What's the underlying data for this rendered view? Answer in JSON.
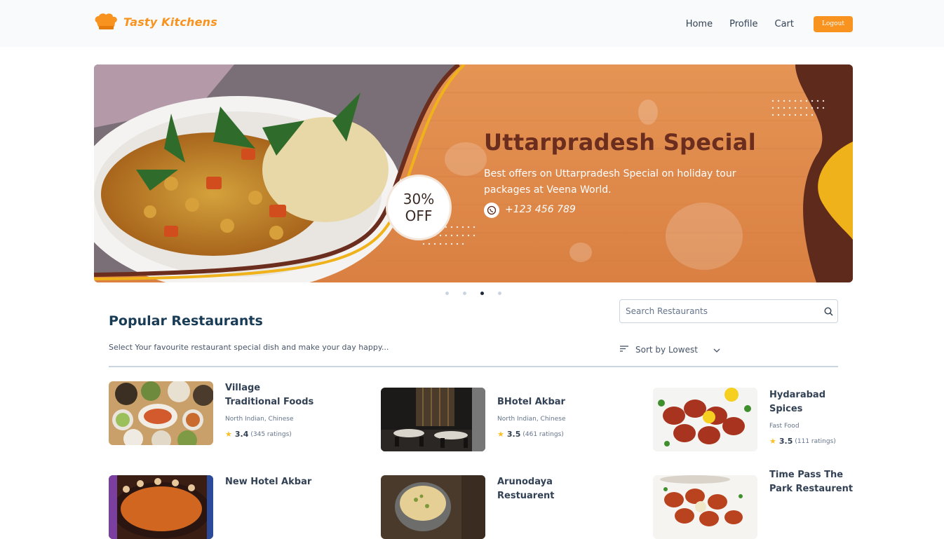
{
  "header": {
    "logo_text": "Tasty Kitchens",
    "nav": [
      "Home",
      "Profile",
      "Cart"
    ],
    "logout_label": "Logout"
  },
  "banner": {
    "title": "Uttarpradesh Special",
    "subtitle": "Best offers on Uttarpradesh Special on holiday tour packages at Veena World.",
    "phone": "+123 456 789",
    "offer_pct": "30%",
    "offer_off": "OFF"
  },
  "carousel": {
    "dot_count": 4,
    "active_index": 2
  },
  "section": {
    "title": "Popular Restaurants",
    "description": "Select Your favourite restaurant special dish and make your day happy..."
  },
  "search": {
    "placeholder": "Search Restaurants"
  },
  "sort": {
    "label": "Sort by Lowest"
  },
  "restaurants": [
    {
      "name": "Village Traditional Foods",
      "cuisine": "North Indian, Chinese",
      "rating": "3.4",
      "ratings_count": "(345 ratings)"
    },
    {
      "name": "BHotel Akbar",
      "cuisine": "North Indian, Chinese",
      "rating": "3.5",
      "ratings_count": "(461 ratings)"
    },
    {
      "name": "Hydarabad Spices",
      "cuisine": "Fast Food",
      "rating": "3.5",
      "ratings_count": "(111 ratings)"
    },
    {
      "name": "New Hotel Akbar",
      "cuisine": "",
      "rating": "",
      "ratings_count": ""
    },
    {
      "name": "Arunodaya Restuarent",
      "cuisine": "",
      "rating": "",
      "ratings_count": ""
    },
    {
      "name": "Time Pass The Park Restaurent",
      "cuisine": "",
      "rating": "",
      "ratings_count": ""
    }
  ],
  "colors": {
    "accent": "#f7931e",
    "heading": "#183b56",
    "star": "#fbbf24",
    "banner_brown": "#6b2d1d"
  }
}
